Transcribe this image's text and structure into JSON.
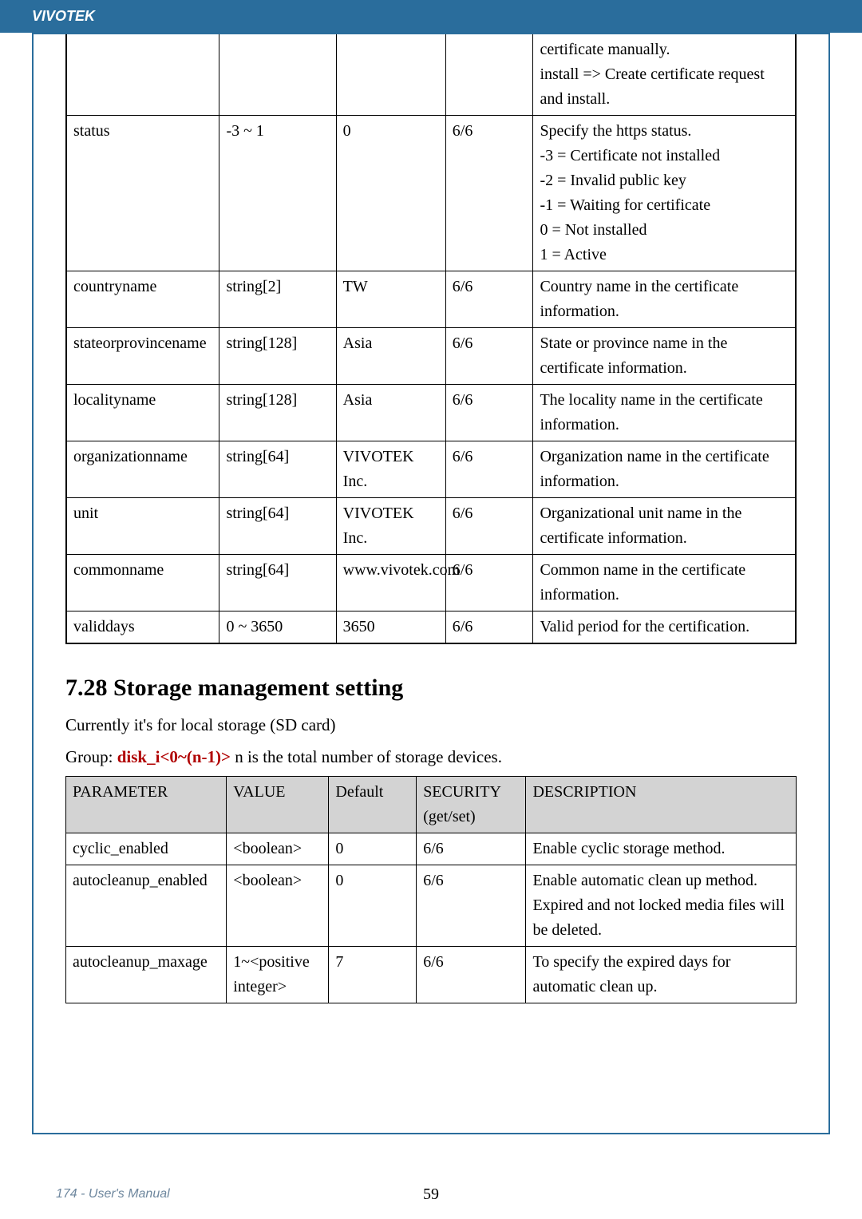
{
  "header": {
    "brand": "VIVOTEK"
  },
  "footer": {
    "left": "174 - User's Manual",
    "center": "59"
  },
  "table1": {
    "rows": [
      {
        "name": "",
        "value": "",
        "default": "",
        "security": "",
        "description": "certificate manually.\ninstall => Create certificate request and install."
      },
      {
        "name": "status",
        "value": "-3 ~ 1",
        "default": "0",
        "security": "6/6",
        "description": "Specify the https status.\n-3 = Certificate not installed\n-2 = Invalid public key\n-1 = Waiting for certificate\n0 = Not installed\n1 = Active"
      },
      {
        "name": "countryname",
        "value": "string[2]",
        "default": "TW",
        "security": "6/6",
        "description": "Country name in the certificate information."
      },
      {
        "name": "stateorprovincename",
        "value": "string[128]",
        "default": "Asia",
        "security": "6/6",
        "description": "State or province name in the certificate information."
      },
      {
        "name": "localityname",
        "value": "string[128]",
        "default": "Asia",
        "security": "6/6",
        "description": "The locality name in the certificate information."
      },
      {
        "name": "organizationname",
        "value": "string[64]",
        "default": "VIVOTEK Inc.",
        "security": "6/6",
        "description": "Organization name in the certificate information."
      },
      {
        "name": "unit",
        "value": "string[64]",
        "default": "VIVOTEK Inc.",
        "security": "6/6",
        "description": "Organizational unit name in the certificate information."
      },
      {
        "name": "commonname",
        "value": "string[64]",
        "default": "www.vivotek.com",
        "security": "6/6",
        "description": "Common name in the certificate information."
      },
      {
        "name": "validdays",
        "value": "0 ~ 3650",
        "default": "3650",
        "security": "6/6",
        "description": "Valid period for the certification."
      }
    ]
  },
  "section": {
    "heading": "7.28 Storage management setting",
    "sub1": "Currently it's for local storage (SD card)",
    "group_prefix": "Group: ",
    "group_name": "disk_i<0~(n-1)>",
    "group_suffix": " n is the total number of storage devices."
  },
  "table2": {
    "head": {
      "c1": "PARAMETER",
      "c2": "VALUE",
      "c3": "Default",
      "c4": "SECURITY (get/set)",
      "c5": "DESCRIPTION"
    },
    "rows": [
      {
        "name": "cyclic_enabled",
        "value": "<boolean>",
        "default": "0",
        "security": "6/6",
        "description": "Enable cyclic storage method."
      },
      {
        "name": "autocleanup_enabled",
        "value": "<boolean>",
        "default": "0",
        "security": "6/6",
        "description": "Enable automatic clean up method. Expired and not locked media files will be deleted."
      },
      {
        "name": "autocleanup_maxage",
        "value": "1~<positive integer>",
        "default": "7",
        "security": "6/6",
        "description": "To specify the expired days for automatic clean up."
      }
    ]
  }
}
